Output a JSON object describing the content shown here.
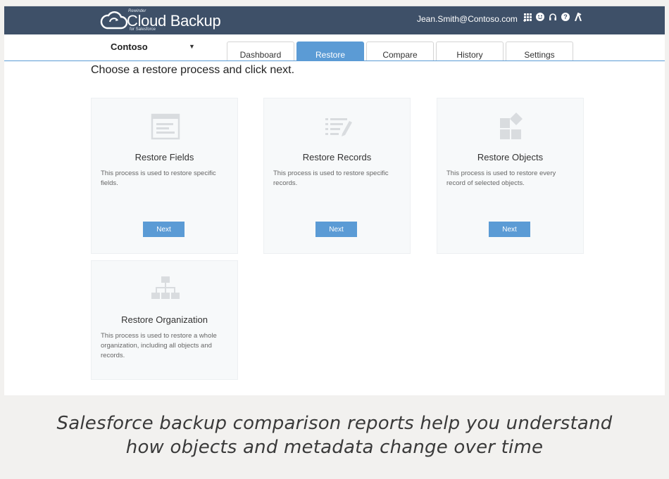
{
  "header": {
    "brand_small": "Rewinder",
    "brand_name": "Cloud Backup",
    "brand_sub": "for Salesforce",
    "user_email": "Jean.Smith@Contoso.com",
    "icons": [
      "apps-grid-icon",
      "smiley-icon",
      "headset-icon",
      "help-icon",
      "logo-k-icon"
    ]
  },
  "org": {
    "name": "Contoso"
  },
  "tabs": [
    {
      "label": "Dashboard",
      "active": false
    },
    {
      "label": "Restore",
      "active": true
    },
    {
      "label": "Compare",
      "active": false
    },
    {
      "label": "History",
      "active": false
    },
    {
      "label": "Settings",
      "active": false
    }
  ],
  "instruction": "Choose a restore process and click next.",
  "cards": [
    {
      "title": "Restore Fields",
      "desc": "This process is used to restore specific fields.",
      "button": "Next",
      "icon": "fields-icon"
    },
    {
      "title": "Restore Records",
      "desc": "This process is used to restore specific records.",
      "button": "Next",
      "icon": "records-icon"
    },
    {
      "title": "Restore Objects",
      "desc": "This process is used to restore every record of selected objects.",
      "button": "Next",
      "icon": "objects-icon"
    },
    {
      "title": "Restore Organization",
      "desc": "This process is used to restore a whole organization, including all objects and records.",
      "icon": "organization-icon"
    }
  ],
  "caption": {
    "line1": "Salesforce backup comparison reports help you understand",
    "line2": "how objects and metadata change over time"
  },
  "colors": {
    "header_bg": "#3e5068",
    "accent": "#5b9bd5",
    "card_bg": "#f7f9fa",
    "icon_gray": "#d9dcdf"
  }
}
